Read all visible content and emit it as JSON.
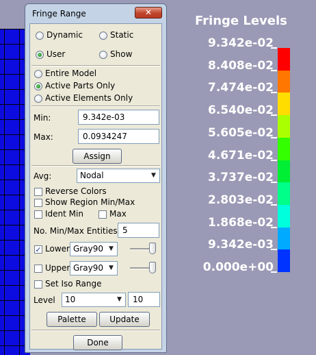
{
  "dialog": {
    "title": "Fringe Range",
    "close_glyph": "✕",
    "range_mode": {
      "dynamic_label": "Dynamic",
      "static_label": "Static",
      "user_label": "User",
      "show_label": "Show",
      "selected": "User"
    },
    "scope": {
      "entire_model_label": "Entire Model",
      "active_parts_label": "Active Parts Only",
      "active_elements_label": "Active Elements Only",
      "selected": "Active Parts Only"
    },
    "min_label": "Min:",
    "min_value": "9.342e-03",
    "max_label": "Max:",
    "max_value": "0.0934247",
    "assign_label": "Assign",
    "avg_label": "Avg:",
    "avg_value": "Nodal",
    "reverse_colors_label": "Reverse Colors",
    "show_region_label": "Show Region Min/Max",
    "ident_min_label": "Ident Min",
    "max_chk_label": "Max",
    "num_entities_label": "No. Min/Max Entities",
    "num_entities_value": "5",
    "lower_label": "Lower",
    "lower_checked": true,
    "lower_color": "Gray90",
    "upper_label": "Upper",
    "upper_checked": false,
    "upper_color": "Gray90",
    "set_iso_label": "Set Iso Range",
    "level_label": "Level",
    "level_select": "10",
    "level_value": "10",
    "palette_label": "Palette",
    "update_label": "Update",
    "done_label": "Done"
  },
  "legend": {
    "title": "Fringe Levels",
    "labels": [
      "9.342e-02",
      "8.408e-02",
      "7.474e-02",
      "6.540e-02",
      "5.605e-02",
      "4.671e-02",
      "3.737e-02",
      "2.803e-02",
      "1.868e-02",
      "9.342e-03",
      "0.000e+00"
    ],
    "band_colors": [
      "#ff0000",
      "#ff7700",
      "#ffdd00",
      "#aaff00",
      "#33ff00",
      "#00ee33",
      "#00ff88",
      "#00ffdd",
      "#00aaff",
      "#0033ff"
    ]
  },
  "mesh_color": "#0c0ce0"
}
